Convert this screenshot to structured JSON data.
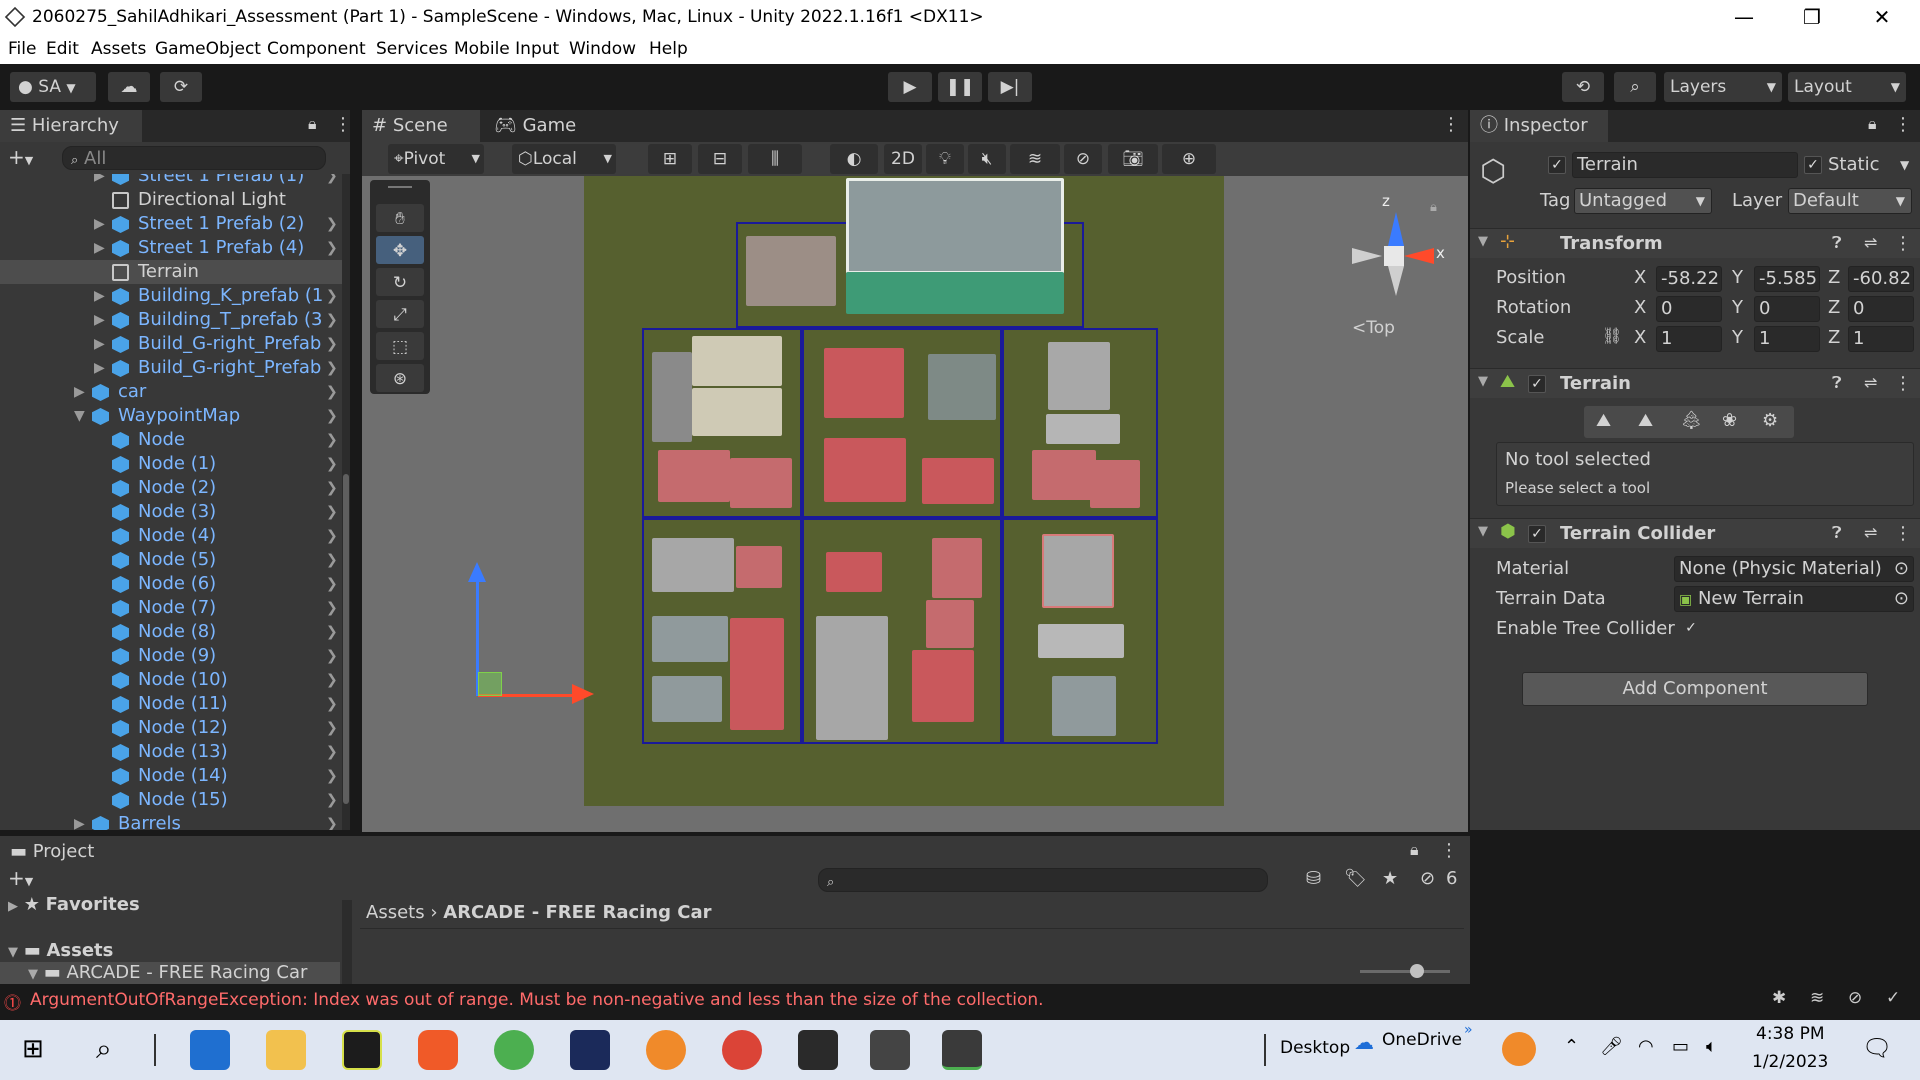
{
  "window": {
    "title": "2060275_SahilAdhikari_Assessment (Part 1) - SampleScene - Windows, Mac, Linux - Unity 2022.1.16f1 <DX11>",
    "minimize": "—",
    "maximize": "❐",
    "close": "✕"
  },
  "menu": [
    "File",
    "Edit",
    "Assets",
    "GameObject",
    "Component",
    "Services",
    "Mobile Input",
    "Window",
    "Help"
  ],
  "toolbar": {
    "account": "SA",
    "layers": "Layers",
    "layout": "Layout"
  },
  "hierarchy": {
    "tab": "Hierarchy",
    "search_placeholder": "All",
    "items": [
      {
        "label": "Street 1 Prefab (1)",
        "prefab": true
      },
      {
        "label": "Directional Light",
        "prefab": false
      },
      {
        "label": "Street 1 Prefab (2)",
        "prefab": true
      },
      {
        "label": "Street 1 Prefab (4)",
        "prefab": true
      },
      {
        "label": "Terrain",
        "prefab": false,
        "selected": true
      },
      {
        "label": "Building_K_prefab (1",
        "prefab": true
      },
      {
        "label": "Building_T_prefab (3",
        "prefab": true
      },
      {
        "label": "Build_G-right_Prefab",
        "prefab": true
      },
      {
        "label": "Build_G-right_Prefab",
        "prefab": true
      },
      {
        "label": "car",
        "prefab": true
      },
      {
        "label": "WaypointMap",
        "prefab": true
      },
      {
        "label": "Node",
        "prefab": true
      },
      {
        "label": "Node (1)",
        "prefab": true
      },
      {
        "label": "Node (2)",
        "prefab": true
      },
      {
        "label": "Node (3)",
        "prefab": true
      },
      {
        "label": "Node (4)",
        "prefab": true
      },
      {
        "label": "Node (5)",
        "prefab": true
      },
      {
        "label": "Node (6)",
        "prefab": true
      },
      {
        "label": "Node (7)",
        "prefab": true
      },
      {
        "label": "Node (8)",
        "prefab": true
      },
      {
        "label": "Node (9)",
        "prefab": true
      },
      {
        "label": "Node (10)",
        "prefab": true
      },
      {
        "label": "Node (11)",
        "prefab": true
      },
      {
        "label": "Node (12)",
        "prefab": true
      },
      {
        "label": "Node (13)",
        "prefab": true
      },
      {
        "label": "Node (14)",
        "prefab": true
      },
      {
        "label": "Node (15)",
        "prefab": true
      },
      {
        "label": "Barrels",
        "prefab": true
      }
    ]
  },
  "scene": {
    "tab_scene": "Scene",
    "tab_game": "Game",
    "pivot": "Pivot",
    "local": "Local",
    "mode_2d": "2D",
    "gizmo_view": "<Top",
    "axis_x": "x",
    "axis_z": "z"
  },
  "inspector": {
    "tab": "Inspector",
    "object_name": "Terrain",
    "static_label": "Static",
    "tag_label": "Tag",
    "tag_value": "Untagged",
    "layer_label": "Layer",
    "layer_value": "Default",
    "transform": {
      "title": "Transform",
      "position_label": "Position",
      "rotation_label": "Rotation",
      "scale_label": "Scale",
      "position": {
        "x": "-58.22",
        "y": "-5.585",
        "z": "-60.82"
      },
      "rotation": {
        "x": "0",
        "y": "0",
        "z": "0"
      },
      "scale": {
        "x": "1",
        "y": "1",
        "z": "1"
      }
    },
    "terrain": {
      "title": "Terrain",
      "no_tool": "No tool selected",
      "please_select": "Please select a tool"
    },
    "collider": {
      "title": "Terrain Collider",
      "material_label": "Material",
      "material_value": "None (Physic Material)",
      "terrain_data_label": "Terrain Data",
      "terrain_data_value": "New Terrain",
      "enable_tree_label": "Enable Tree Collider"
    },
    "add_component": "Add Component"
  },
  "project": {
    "tab": "Project",
    "favorites": "Favorites",
    "assets": "Assets",
    "folder": "ARCADE - FREE Racing Car",
    "breadcrumb_root": "Assets",
    "breadcrumb_current": "ARCADE - FREE Racing Car",
    "hidden_count": "6"
  },
  "console": {
    "error": "ArgumentOutOfRangeException: Index was out of range. Must be non-negative and less than the size of the collection."
  },
  "taskbar": {
    "desktop": "Desktop",
    "onedrive": "OneDrive",
    "time": "4:38 PM",
    "date": "1/2/2023"
  }
}
